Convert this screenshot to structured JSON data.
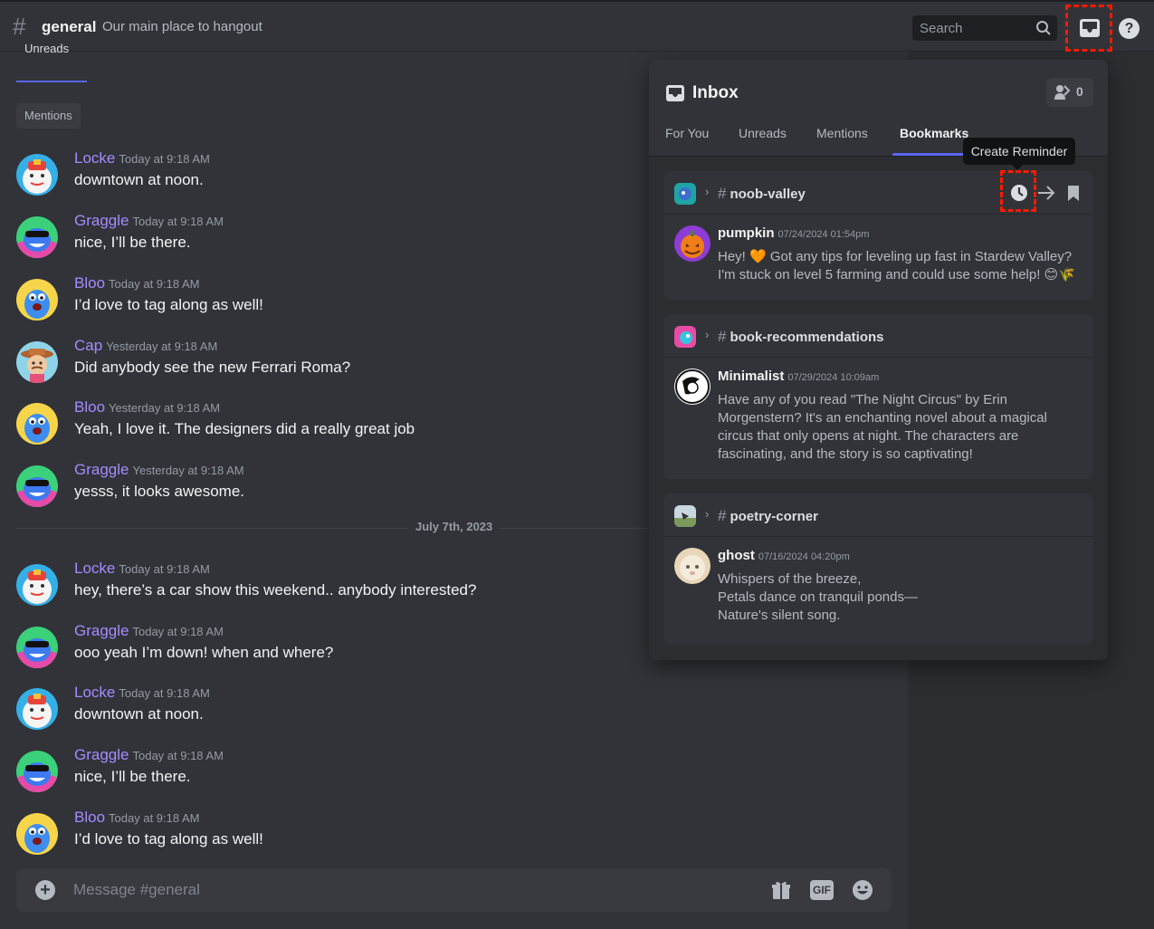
{
  "header": {
    "channel_name": "general",
    "channel_topic": "Our main place to hangout",
    "search_placeholder": "Search",
    "help_label": "?"
  },
  "chat": {
    "unreads_label": "Unreads",
    "mentions_label": "Mentions",
    "divider_date": "July 7th, 2023",
    "messages": [
      {
        "author": "Locke",
        "time": "Today at 9:18 AM",
        "text": "downtown at noon."
      },
      {
        "author": "Graggle",
        "time": "Today at 9:18 AM",
        "text": "nice, I’ll be there."
      },
      {
        "author": "Bloo",
        "time": "Today at 9:18 AM",
        "text": "I’d love to tag along as well!"
      },
      {
        "author": "Cap",
        "time": "Yesterday at 9:18 AM",
        "text": "Did anybody see the new Ferrari Roma?"
      },
      {
        "author": "Bloo",
        "time": "Yesterday at 9:18 AM",
        "text": "Yeah, I love it. The designers did a really great job"
      },
      {
        "author": "Graggle",
        "time": "Yesterday at 9:18 AM",
        "text": "yesss, it looks awesome."
      },
      {
        "author": "Locke",
        "time": "Today at 9:18 AM",
        "text": "hey, there’s a car show this weekend.. anybody interested?"
      },
      {
        "author": "Graggle",
        "time": "Today at 9:18 AM",
        "text": "ooo yeah I’m down! when and where?"
      },
      {
        "author": "Locke",
        "time": "Today at 9:18 AM",
        "text": "downtown at noon."
      },
      {
        "author": "Graggle",
        "time": "Today at 9:18 AM",
        "text": "nice, I’ll be there."
      },
      {
        "author": "Bloo",
        "time": "Today at 9:18 AM",
        "text": "I’d love to tag along as well!"
      }
    ]
  },
  "composer": {
    "placeholder": "Message #general",
    "gif_label": "GIF"
  },
  "inbox": {
    "title": "Inbox",
    "request_count": "0",
    "tabs": [
      "For You",
      "Unreads",
      "Mentions",
      "Bookmarks"
    ],
    "active_tab": "Bookmarks",
    "tooltip": "Create Reminder",
    "cards": [
      {
        "channel": "noob-valley",
        "author": "pumpkin",
        "timestamp": "07/24/2024 01:54pm",
        "lines": [
          "Hey! 🧡 Got any tips for leveling up fast in Stardew Valley?",
          "I'm stuck on level 5 farming and could use some help! 😊🌾"
        ]
      },
      {
        "channel": "book-recommendations",
        "author": "Minimalist",
        "timestamp": "07/29/2024 10:09am",
        "lines": [
          "Have any of you read \"The Night Circus\" by Erin",
          "Morgenstern? It's an enchanting novel about a magical",
          "circus that only opens at night. The characters are",
          "fascinating, and the story is so captivating!"
        ]
      },
      {
        "channel": "poetry-corner",
        "author": "ghost",
        "timestamp": "07/16/2024 04:20pm",
        "lines": [
          "Whispers of the breeze,",
          "Petals dance on tranquil ponds—",
          "Nature's silent song."
        ]
      }
    ]
  },
  "colors": {
    "accent": "#5865f2",
    "username": "#a58bff",
    "highlight_box": "#ff1a00"
  },
  "icons": [
    "hash-icon",
    "search-icon",
    "inbox-icon",
    "help-icon",
    "add-icon",
    "gift-icon",
    "gif-icon",
    "emoji-icon",
    "clock-icon",
    "forward-arrow-icon",
    "bookmark-icon",
    "message-requests-icon"
  ]
}
